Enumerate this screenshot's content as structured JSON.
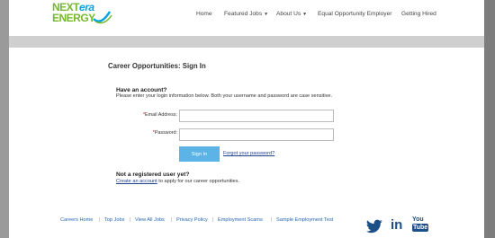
{
  "logo": {
    "line1_a": "NEXT",
    "line1_b": "era",
    "line2": "ENERGY"
  },
  "nav": [
    {
      "label": "Home",
      "dropdown": false
    },
    {
      "label": "Featured Jobs",
      "dropdown": true
    },
    {
      "label": "About Us",
      "dropdown": true
    },
    {
      "label": "Equal Opportunity Employer",
      "dropdown": false
    },
    {
      "label": "Getting Hired",
      "dropdown": false
    }
  ],
  "page_title": "Career Opportunities: Sign In",
  "signin": {
    "heading": "Have an account?",
    "instructions": "Please enter your login information below. Both your username and password are case sensitive.",
    "email_label": "Email Address:",
    "email_value": "",
    "password_label": "Password:",
    "password_value": "",
    "required_mark": "*",
    "button_label": "Sign In",
    "forgot_label": "Forgot your password?"
  },
  "register": {
    "heading": "Not a registered user yet?",
    "link_label": "Create an account",
    "suffix": " to apply for our career opportunities."
  },
  "footer": {
    "links": [
      "Careers Home",
      "Top Jobs",
      "View All Jobs",
      "Privacy Policy",
      "Employment Scams",
      "Sample Employment Test"
    ],
    "separator": "|"
  },
  "social": {
    "youtube_top": "You",
    "youtube_bottom": "Tube",
    "linkedin": "in"
  },
  "colors": {
    "brand_green": "#76b82a",
    "brand_blue": "#00a3e0",
    "button": "#5bb4e5",
    "link": "#2a66b0",
    "twitter": "#1c4f86"
  }
}
